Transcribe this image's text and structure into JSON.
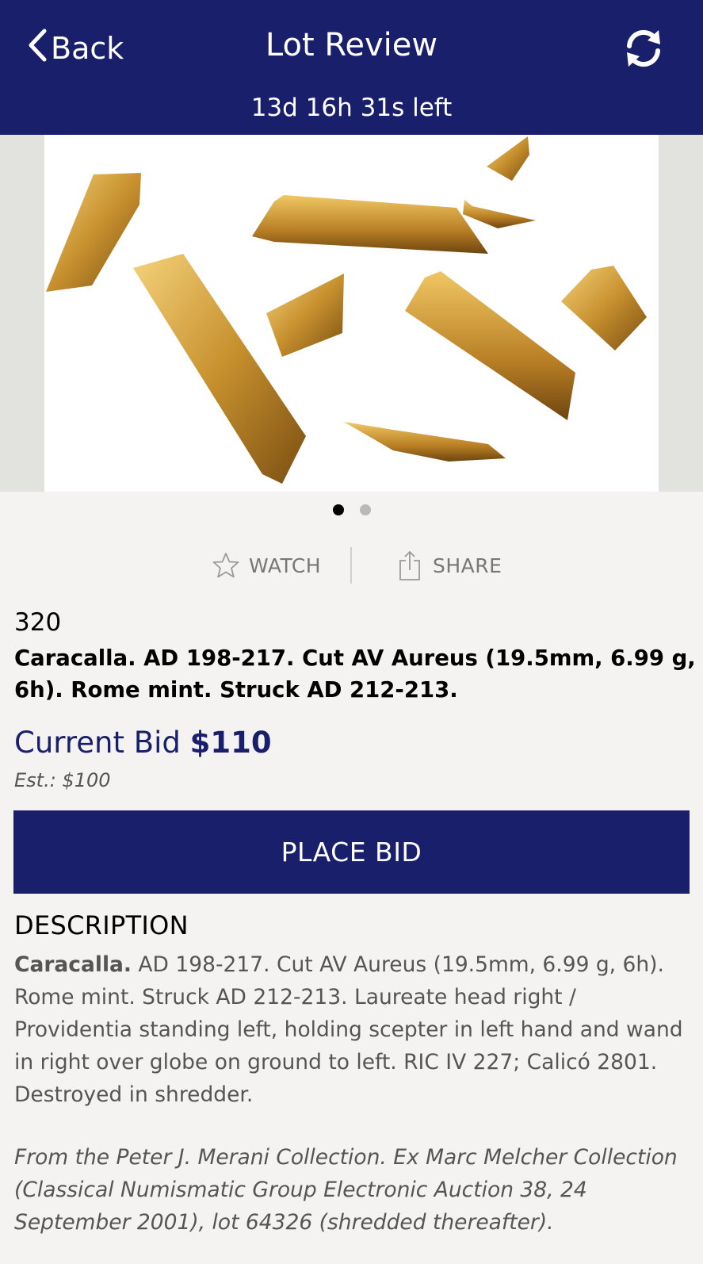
{
  "header": {
    "back_label": "Back",
    "title": "Lot Review",
    "time_left": "13d 16h 31s left",
    "refresh_icon": "refresh-icon"
  },
  "gallery": {
    "image_alt": "Cut gold aureus fragments",
    "page_count": 2,
    "active_page": 1
  },
  "actions": {
    "watch_label": "WATCH",
    "share_label": "SHARE"
  },
  "lot": {
    "number": "320",
    "title": "Caracalla. AD 198-217. Cut AV Aureus (19.5mm, 6.99 g, 6h). Rome mint. Struck AD 212-213.",
    "current_bid_label": "Current Bid",
    "current_bid_amount": "$110",
    "estimate": "Est.: $100"
  },
  "place_bid_label": "PLACE BID",
  "description": {
    "heading": "DESCRIPTION",
    "ruler": "Caracalla.",
    "body": " AD 198-217. Cut AV Aureus (19.5mm, 6.99 g, 6h). Rome mint. Struck AD 212-213. Laureate head right / Providentia standing left, holding scepter in left hand and wand in right over globe on ground to left. RIC IV 227; Calicó 2801. Destroyed in shredder.",
    "provenance": "From the Peter J. Merani Collection. Ex Marc Melcher Collection (Classical Numismatic Group Electronic Auction 38, 24 September 2001), lot 64326 (shredded thereafter)."
  },
  "colors": {
    "brand_navy": "#1a1f6b",
    "background": "#f4f3f1",
    "gold": "#c8912f"
  }
}
